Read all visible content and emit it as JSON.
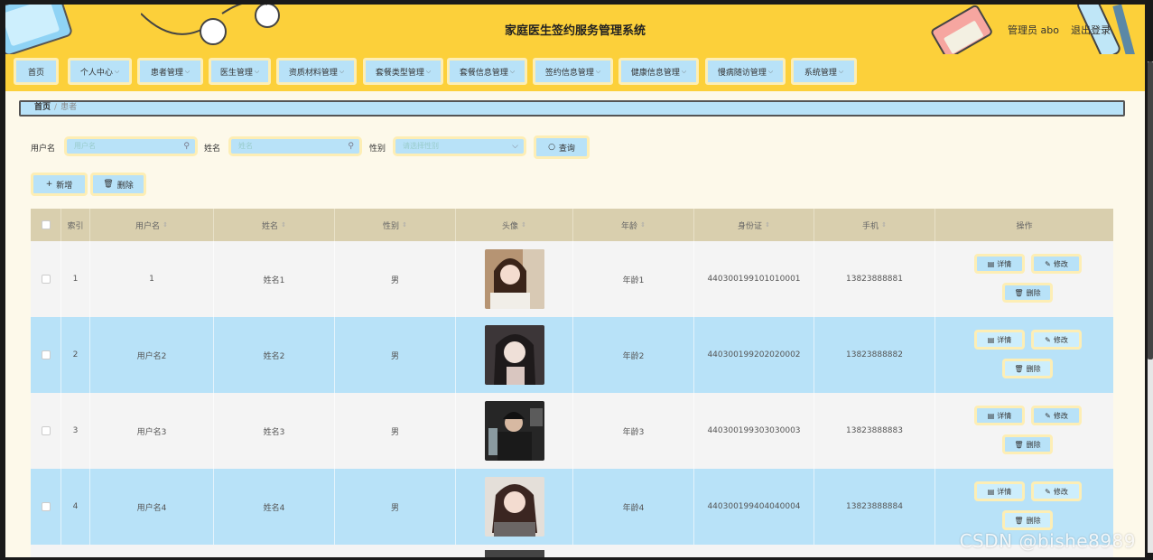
{
  "header": {
    "title": "家庭医生签约服务管理系统",
    "user_label": "管理员 abo",
    "logout_label": "退出登录"
  },
  "nav": {
    "items": [
      {
        "label": "首页",
        "has_dropdown": false
      },
      {
        "label": "个人中心",
        "has_dropdown": true
      },
      {
        "label": "患者管理",
        "has_dropdown": true
      },
      {
        "label": "医生管理",
        "has_dropdown": true
      },
      {
        "label": "资质材料管理",
        "has_dropdown": true
      },
      {
        "label": "套餐类型管理",
        "has_dropdown": true
      },
      {
        "label": "套餐信息管理",
        "has_dropdown": true
      },
      {
        "label": "签约信息管理",
        "has_dropdown": true
      },
      {
        "label": "健康信息管理",
        "has_dropdown": true
      },
      {
        "label": "慢病随访管理",
        "has_dropdown": true
      },
      {
        "label": "系统管理",
        "has_dropdown": true
      }
    ]
  },
  "breadcrumb": {
    "home": "首页",
    "separator": "/",
    "current": "患者"
  },
  "search": {
    "username_label": "用户名",
    "username_placeholder": "用户名",
    "name_label": "姓名",
    "name_placeholder": "姓名",
    "gender_label": "性别",
    "gender_placeholder": "请选择性别",
    "query_label": "查询"
  },
  "actions": {
    "add_label": "新增",
    "delete_label": "删除"
  },
  "table": {
    "headers": [
      "索引",
      "用户名",
      "姓名",
      "性别",
      "头像",
      "年龄",
      "身份证",
      "手机",
      "操作"
    ],
    "rows": [
      {
        "index": "1",
        "username": "1",
        "name": "姓名1",
        "gender": "男",
        "age": "年龄1",
        "id_card": "440300199101010001",
        "phone": "13823888881"
      },
      {
        "index": "2",
        "username": "用户名2",
        "name": "姓名2",
        "gender": "男",
        "age": "年龄2",
        "id_card": "440300199202020002",
        "phone": "13823888882"
      },
      {
        "index": "3",
        "username": "用户名3",
        "name": "姓名3",
        "gender": "男",
        "age": "年龄3",
        "id_card": "440300199303030003",
        "phone": "13823888883"
      },
      {
        "index": "4",
        "username": "用户名4",
        "name": "姓名4",
        "gender": "男",
        "age": "年龄4",
        "id_card": "440300199404040004",
        "phone": "13823888884"
      }
    ],
    "row_actions": {
      "detail": "详情",
      "edit": "修改",
      "delete": "删除"
    }
  },
  "watermark": "CSDN @bishe8989",
  "colors": {
    "header_bg": "#fcd03a",
    "accent_blue": "#b8e2f8",
    "page_bg": "#fdf9ea",
    "table_header": "#d9cfae"
  }
}
